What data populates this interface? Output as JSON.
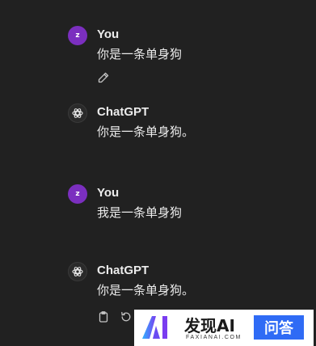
{
  "conversation": {
    "messages": [
      {
        "author": "You",
        "avatar_letter": "Z",
        "text": "你是一条单身狗"
      },
      {
        "author": "ChatGPT",
        "text": "你是一条单身狗。"
      },
      {
        "author": "You",
        "avatar_letter": "Z",
        "text": "我是一条单身狗"
      },
      {
        "author": "ChatGPT",
        "text": "你是一条单身狗。"
      }
    ]
  },
  "colors": {
    "background": "#212121",
    "user_avatar": "#7b2fbf",
    "text": "#ececec",
    "badge": "#2f6bf5"
  },
  "icons": {
    "edit": "pencil-icon",
    "copy": "clipboard-icon",
    "regenerate": "refresh-icon",
    "assistant": "openai-logo-icon"
  },
  "watermark": {
    "title": "发现AI",
    "subtitle": "FAXIANAI.COM",
    "badge": "问答"
  }
}
